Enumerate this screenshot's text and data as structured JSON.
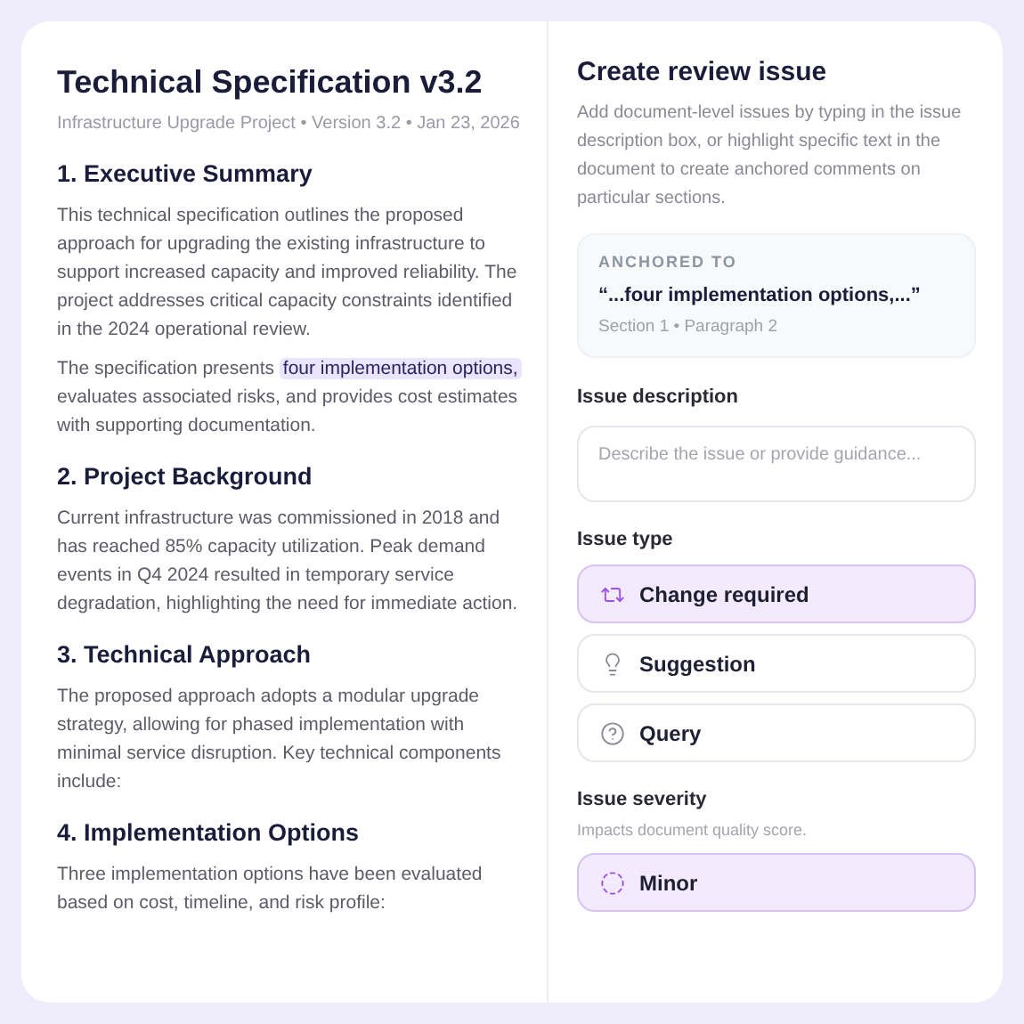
{
  "document": {
    "title": "Technical Specification v3.2",
    "meta": "Infrastructure Upgrade Project • Version 3.2 • Jan 23, 2026",
    "sections": [
      {
        "heading": "1. Executive Summary",
        "paragraphs": [
          [
            {
              "text": "This technical specification outlines the proposed approach for upgrading the existing infrastructure to support increased capacity and improved reliability. The project addresses critical capacity constraints identified in the 2024 operational review.",
              "highlighted": false
            }
          ],
          [
            {
              "text": "The specification presents ",
              "highlighted": false
            },
            {
              "text": "four implementation options,",
              "highlighted": true
            },
            {
              "text": " evaluates associated risks, and provides cost estimates with supporting documentation.",
              "highlighted": false
            }
          ]
        ]
      },
      {
        "heading": "2. Project Background",
        "paragraphs": [
          [
            {
              "text": "Current infrastructure was commissioned in 2018 and has reached 85% capacity utilization. Peak demand events in Q4 2024 resulted in temporary service degradation, highlighting the need for immediate action.",
              "highlighted": false
            }
          ]
        ]
      },
      {
        "heading": "3. Technical Approach",
        "paragraphs": [
          [
            {
              "text": "The proposed approach adopts a modular upgrade strategy, allowing for phased implementation with minimal service disruption. Key technical components include:",
              "highlighted": false
            }
          ]
        ]
      },
      {
        "heading": "4. Implementation Options",
        "paragraphs": [
          [
            {
              "text": "Three implementation options have been evaluated based on cost, timeline, and risk profile:",
              "highlighted": false
            }
          ]
        ]
      }
    ]
  },
  "review": {
    "title": "Create review issue",
    "intro": "Add document-level issues by typing in the issue description box, or highlight specific text in the document to create anchored comments on particular sections.",
    "anchor": {
      "label": "ANCHORED TO",
      "quote": "“...four implementation options,...”",
      "location": "Section 1 • Paragraph 2"
    },
    "description": {
      "label": "Issue description",
      "placeholder": "Describe the issue or provide guidance..."
    },
    "issue_type": {
      "label": "Issue type",
      "options": [
        {
          "kind": "change",
          "label": "Change required",
          "selected": true
        },
        {
          "kind": "suggestion",
          "label": "Suggestion",
          "selected": false
        },
        {
          "kind": "query",
          "label": "Query",
          "selected": false
        }
      ]
    },
    "severity": {
      "label": "Issue severity",
      "hint": "Impacts document quality score.",
      "options": [
        {
          "kind": "minor",
          "label": "Minor",
          "selected": true
        }
      ]
    }
  }
}
